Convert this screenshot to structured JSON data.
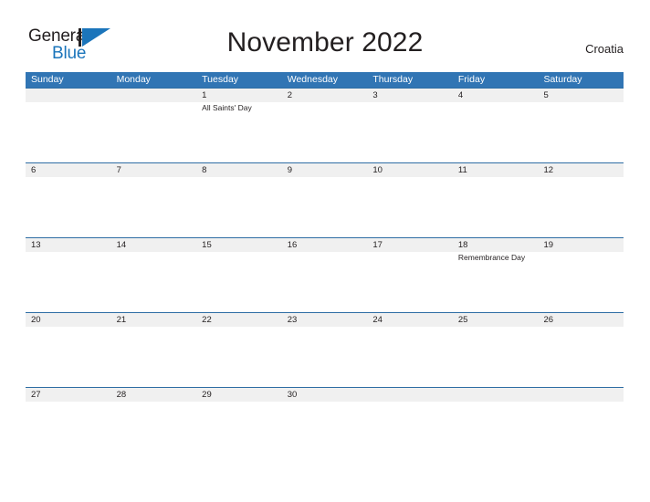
{
  "brand": {
    "name_part1": "General",
    "name_part2": "Blue",
    "triangle_color": "#1b75bb",
    "text_color": "#231f20"
  },
  "header": {
    "title": "November 2022",
    "region": "Croatia",
    "header_bg": "#3175b4",
    "header_text_color": "#ffffff",
    "row_line_color": "#2e6da4",
    "day_band_bg": "#f0f0f0"
  },
  "weekdays": [
    "Sunday",
    "Monday",
    "Tuesday",
    "Wednesday",
    "Thursday",
    "Friday",
    "Saturday"
  ],
  "weeks": [
    {
      "days": [
        {
          "date": "",
          "event": ""
        },
        {
          "date": "",
          "event": ""
        },
        {
          "date": "1",
          "event": "All Saints' Day"
        },
        {
          "date": "2",
          "event": ""
        },
        {
          "date": "3",
          "event": ""
        },
        {
          "date": "4",
          "event": ""
        },
        {
          "date": "5",
          "event": ""
        }
      ]
    },
    {
      "days": [
        {
          "date": "6",
          "event": ""
        },
        {
          "date": "7",
          "event": ""
        },
        {
          "date": "8",
          "event": ""
        },
        {
          "date": "9",
          "event": ""
        },
        {
          "date": "10",
          "event": ""
        },
        {
          "date": "11",
          "event": ""
        },
        {
          "date": "12",
          "event": ""
        }
      ]
    },
    {
      "days": [
        {
          "date": "13",
          "event": ""
        },
        {
          "date": "14",
          "event": ""
        },
        {
          "date": "15",
          "event": ""
        },
        {
          "date": "16",
          "event": ""
        },
        {
          "date": "17",
          "event": ""
        },
        {
          "date": "18",
          "event": "Remembrance Day"
        },
        {
          "date": "19",
          "event": ""
        }
      ]
    },
    {
      "days": [
        {
          "date": "20",
          "event": ""
        },
        {
          "date": "21",
          "event": ""
        },
        {
          "date": "22",
          "event": ""
        },
        {
          "date": "23",
          "event": ""
        },
        {
          "date": "24",
          "event": ""
        },
        {
          "date": "25",
          "event": ""
        },
        {
          "date": "26",
          "event": ""
        }
      ]
    },
    {
      "days": [
        {
          "date": "27",
          "event": ""
        },
        {
          "date": "28",
          "event": ""
        },
        {
          "date": "29",
          "event": ""
        },
        {
          "date": "30",
          "event": ""
        },
        {
          "date": "",
          "event": ""
        },
        {
          "date": "",
          "event": ""
        },
        {
          "date": "",
          "event": ""
        }
      ]
    }
  ]
}
